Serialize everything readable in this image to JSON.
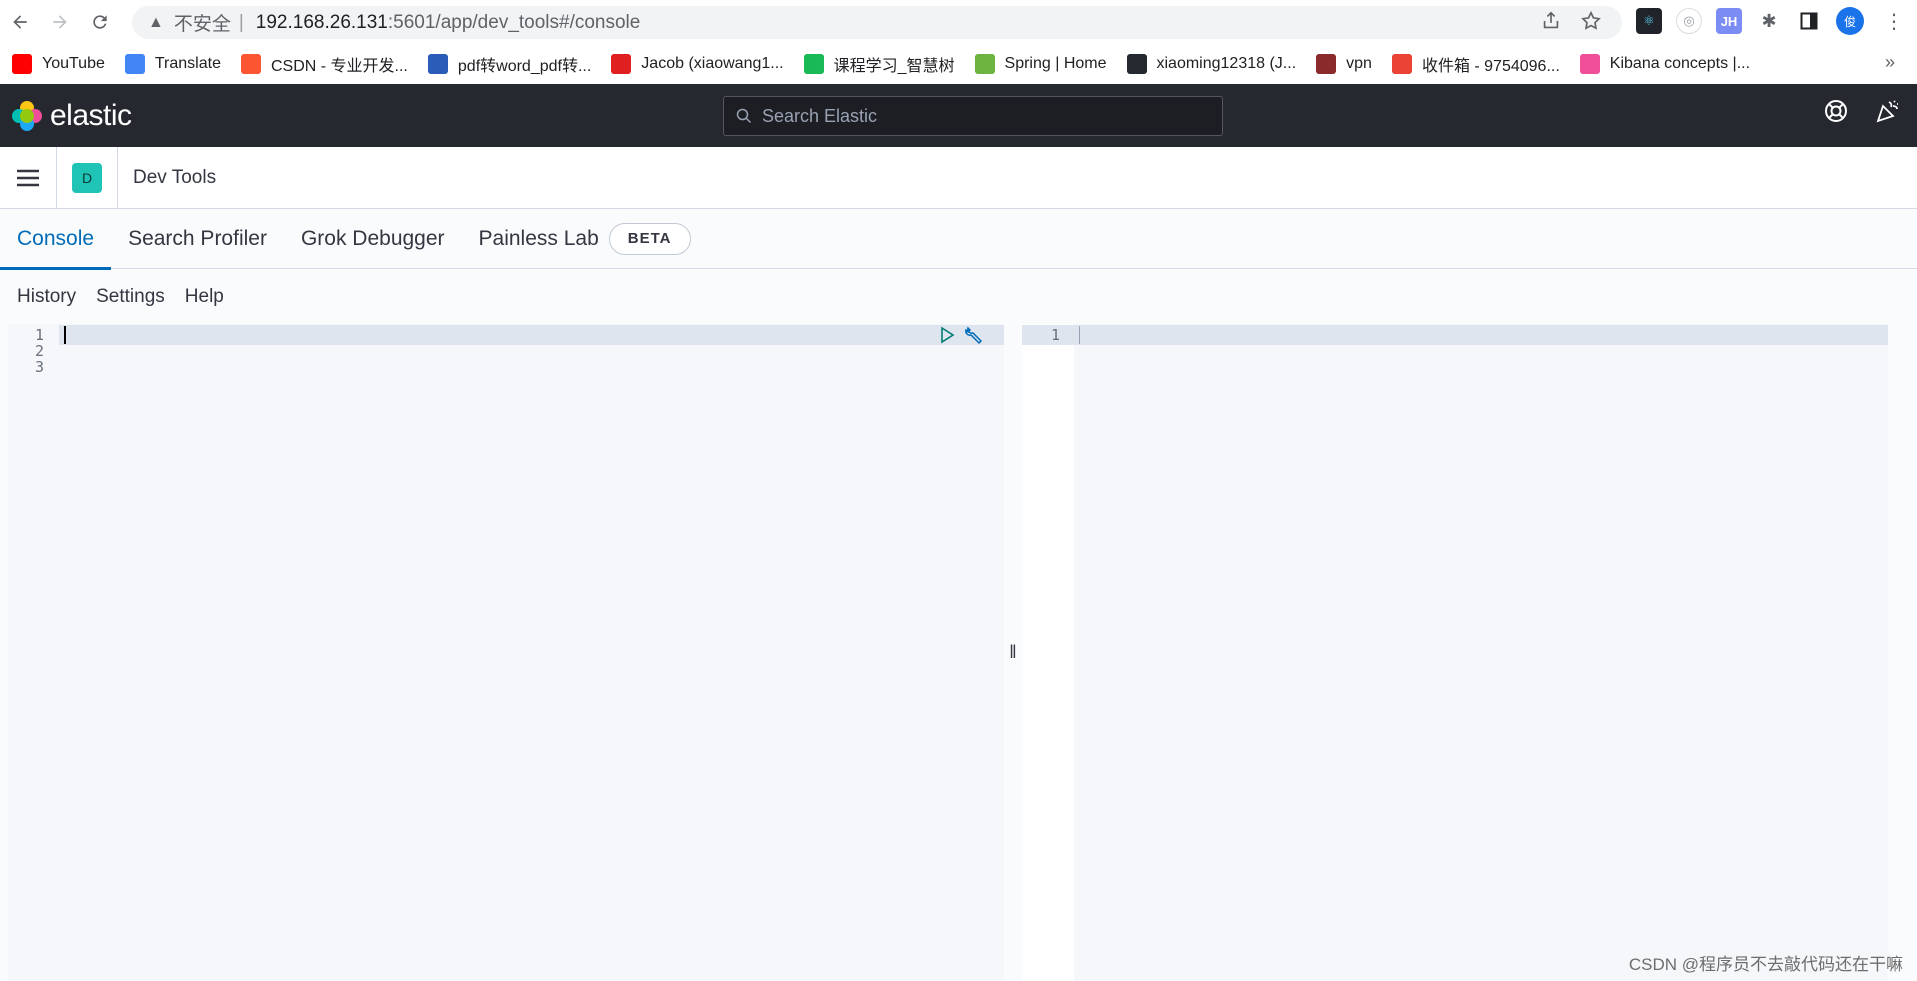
{
  "browser": {
    "insecure_label": "不安全",
    "separator": "|",
    "url_host": "192.168.26.131",
    "url_path": ":5601/app/dev_tools#/console",
    "profile_initial": "俊",
    "ext_jh": "JH"
  },
  "bookmarks": [
    {
      "label": "YouTube",
      "icon": "youtube-icon",
      "color": "#ff0000"
    },
    {
      "label": "Translate",
      "icon": "translate-icon",
      "color": "#4285f4"
    },
    {
      "label": "CSDN - 专业开发...",
      "icon": "csdn-icon",
      "color": "#fc5531"
    },
    {
      "label": "pdf转word_pdf转...",
      "icon": "pdf-icon",
      "color": "#2b5cb8"
    },
    {
      "label": "Jacob (xiaowang1...",
      "icon": "jacob-icon",
      "color": "#e02020"
    },
    {
      "label": "课程学习_智慧树",
      "icon": "zhihuishu-icon",
      "color": "#19b955"
    },
    {
      "label": "Spring | Home",
      "icon": "spring-icon",
      "color": "#6db33f"
    },
    {
      "label": "xiaoming12318 (J...",
      "icon": "github-icon",
      "color": "#24292f"
    },
    {
      "label": "vpn",
      "icon": "vpn-icon",
      "color": "#8b2a2a"
    },
    {
      "label": "收件箱 - 9754096...",
      "icon": "gmail-icon",
      "color": "#ea4335"
    },
    {
      "label": "Kibana concepts |...",
      "icon": "kibana-icon",
      "color": "#f04e98"
    }
  ],
  "bookmarks_more": "»",
  "kibana": {
    "logo_text": "elastic",
    "search_placeholder": "Search Elastic",
    "space_initial": "D",
    "breadcrumb": "Dev Tools"
  },
  "tabs": [
    {
      "label": "Console",
      "active": true
    },
    {
      "label": "Search Profiler"
    },
    {
      "label": "Grok Debugger"
    },
    {
      "label": "Painless Lab"
    }
  ],
  "beta_badge": "BETA",
  "console_menu": [
    "History",
    "Settings",
    "Help"
  ],
  "editor": {
    "line_numbers": [
      "1",
      "2",
      "3"
    ],
    "output_line_numbers": [
      "1"
    ]
  },
  "watermark": "CSDN @程序员不去敲代码还在干嘛",
  "colors": {
    "header_bg": "#25282f",
    "accent": "#006bb8",
    "space_badge": "#20c4b6"
  }
}
